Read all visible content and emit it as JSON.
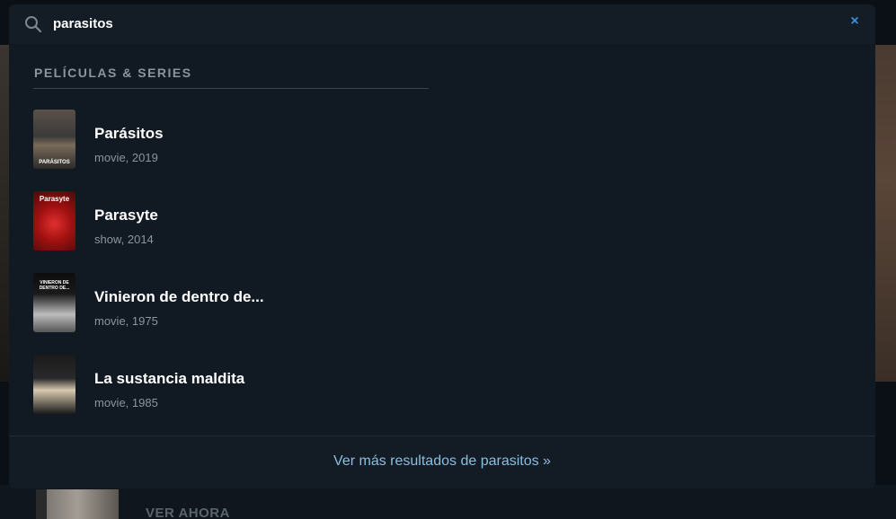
{
  "search": {
    "query": "parasitos",
    "close_label": "×"
  },
  "section": {
    "title": "PELÍCULAS & SERIES"
  },
  "results": [
    {
      "title": "Parásitos",
      "meta": "movie, 2019",
      "poster_label": "PARÁSITOS"
    },
    {
      "title": "Parasyte",
      "meta": "show, 2014",
      "poster_label": "Parasyte"
    },
    {
      "title": "Vinieron de dentro de...",
      "meta": "movie, 1975",
      "poster_label": "VINIERON DE DENTRO DE..."
    },
    {
      "title": "La sustancia maldita",
      "meta": "movie, 1985",
      "poster_label": ""
    }
  ],
  "footer": {
    "more_results": "Ver más resultados de parasitos »"
  },
  "background": {
    "cta_label": "VER AHORA"
  },
  "colors": {
    "accent": "#3a8fd6",
    "link": "#8bbfe0",
    "panel": "#131b24"
  }
}
